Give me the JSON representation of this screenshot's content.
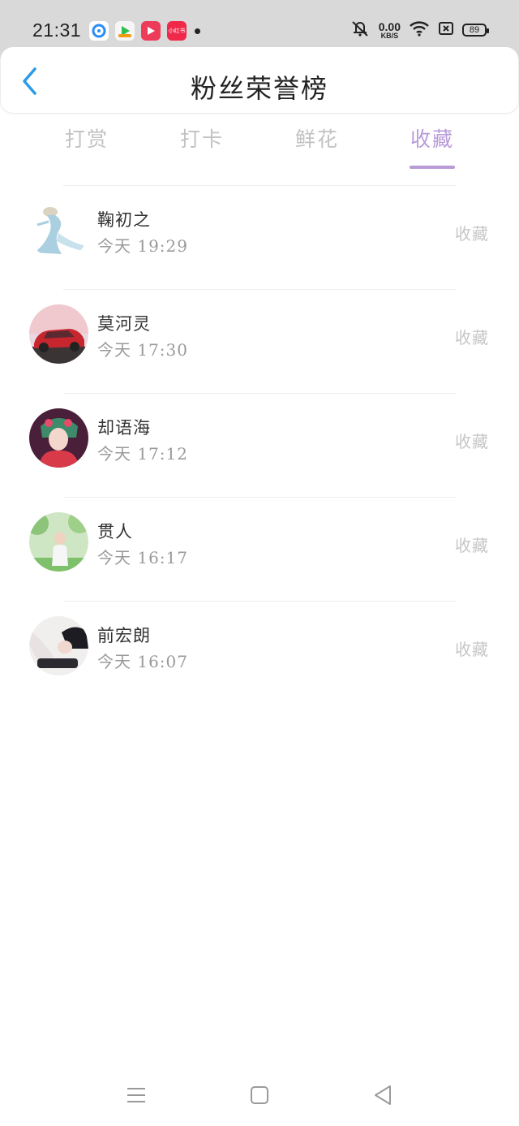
{
  "status_bar": {
    "time": "21:31",
    "net_speed_value": "0.00",
    "net_speed_unit": "KB/S",
    "battery": "89",
    "app_icons": [
      {
        "name": "browser-app-icon",
        "color": "#ffffff",
        "label": ""
      },
      {
        "name": "game-app-icon",
        "color": "#f6f6f6",
        "label": ""
      },
      {
        "name": "video-app-icon",
        "color": "#ec3c5a",
        "label": ""
      },
      {
        "name": "shop-app-icon",
        "color": "#f0284a",
        "label": "小红书"
      }
    ]
  },
  "header": {
    "title": "粉丝荣誉榜",
    "back_icon": "chevron-left-icon",
    "accent_color": "#2b9be8"
  },
  "tabs": [
    {
      "label": "打赏",
      "active": false
    },
    {
      "label": "打卡",
      "active": false
    },
    {
      "label": "鲜花",
      "active": false
    },
    {
      "label": "收藏",
      "active": true
    }
  ],
  "tab_active_color": "#b89bd8",
  "list": [
    {
      "name": "鞠初之",
      "time": "今天  19:29",
      "action": "收藏",
      "avatar": "figure-avatar"
    },
    {
      "name": "莫河灵",
      "time": "今天  17:30",
      "action": "收藏",
      "avatar": "car-avatar"
    },
    {
      "name": "却语海",
      "time": "今天  17:12",
      "action": "收藏",
      "avatar": "opera-avatar"
    },
    {
      "name": "贯人",
      "time": "今天  16:17",
      "action": "收藏",
      "avatar": "outdoor-avatar"
    },
    {
      "name": "前宏朗",
      "time": "今天  16:07",
      "action": "收藏",
      "avatar": "portrait-avatar"
    }
  ],
  "nav_bar": {
    "icons": [
      "menu-icon",
      "home-square-icon",
      "back-triangle-icon"
    ]
  }
}
